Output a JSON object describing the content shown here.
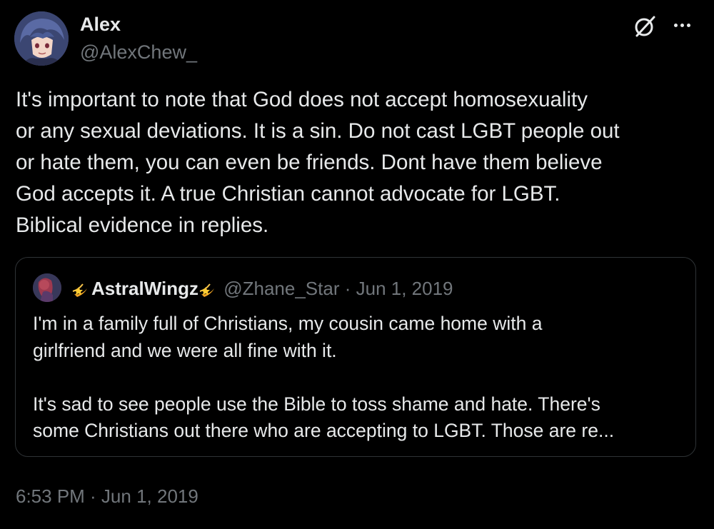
{
  "tweet": {
    "author": {
      "display_name": "Alex",
      "handle": "@AlexChew_"
    },
    "text": "It's important to note that God does not accept homosexuality\nor any sexual deviations. It is a sin. Do not cast LGBT people out\nor hate them, you can even be friends. Dont have them believe\nGod accepts it. A true Christian cannot advocate for LGBT.\nBiblical evidence in replies.",
    "timestamp": "6:53 PM · Jun 1, 2019",
    "icons": {
      "grok": "grok-icon",
      "more": "more-options-icon"
    }
  },
  "quoted_tweet": {
    "display_name": "AstralWingz",
    "name_emoji": "shooting-star-emoji",
    "handle": "@Zhane_Star",
    "separator": " · ",
    "date": "Jun 1, 2019",
    "text": "I'm in a family full of Christians, my cousin came home with a\ngirlfriend and we were all fine with it.\n\nIt's sad to see people use the Bible to toss shame and hate. There's\nsome Christians out there who are accepting to LGBT. Those are re..."
  },
  "colors": {
    "background": "#000000",
    "primary_text": "#e7e9ea",
    "secondary_text": "#71767b",
    "border": "#2f3336"
  }
}
